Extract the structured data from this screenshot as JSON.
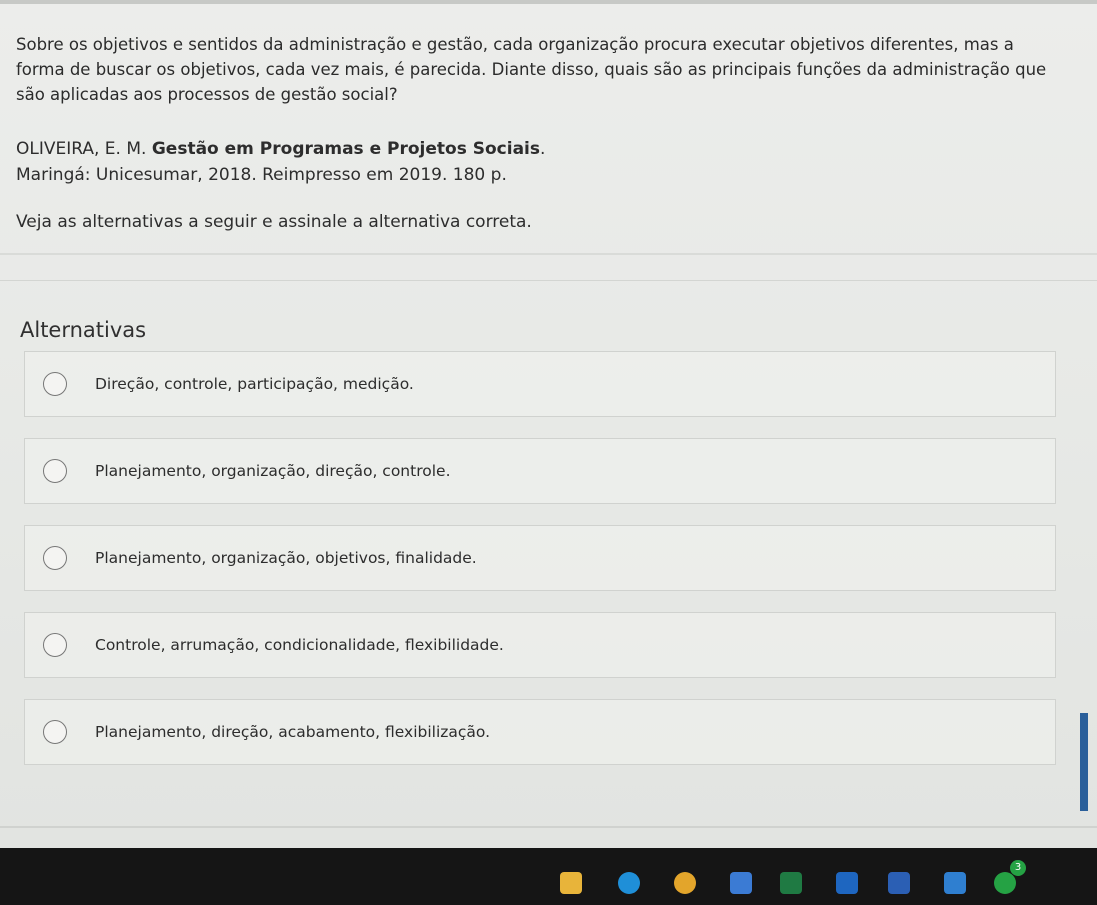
{
  "question": {
    "text": "Sobre os objetivos e sentidos da administração e gestão, cada organização procura executar objetivos diferentes, mas a forma de buscar os objetivos, cada vez mais, é parecida. Diante disso, quais são as principais funções da administração que são aplicadas aos processos de gestão social?",
    "reference_author": "OLIVEIRA, E. M. ",
    "reference_title": "Gestão em Programas e Projetos Sociais",
    "reference_title_end": ".",
    "reference_publisher": "Maringá: Unicesumar, 2018. Reimpresso em 2019. 180 p.",
    "instruction": "Veja as alternativas a seguir e assinale a alternativa correta."
  },
  "alternatives": {
    "title": "Alternativas",
    "options": [
      {
        "label": "Direção, controle, participação, medição."
      },
      {
        "label": "Planejamento, organização, direção, controle."
      },
      {
        "label": "Planejamento, organização, objetivos, finalidade."
      },
      {
        "label": "Controle, arrumação, condicionalidade, flexibilidade."
      },
      {
        "label": "Planejamento, direção, acabamento, flexibilização."
      }
    ]
  },
  "taskbar": {
    "icons": [
      {
        "name": "explorer-icon",
        "color": "#e8b43a"
      },
      {
        "name": "edge-icon",
        "color": "#1f8fd8"
      },
      {
        "name": "chrome-icon",
        "color": "#e3a52b"
      },
      {
        "name": "store-icon",
        "color": "#3b7bd4"
      },
      {
        "name": "excel-icon",
        "color": "#1f7a43"
      },
      {
        "name": "outlook-icon",
        "color": "#1e66c0"
      },
      {
        "name": "word-icon",
        "color": "#2b5fb4"
      },
      {
        "name": "app-icon",
        "color": "#2f7fd0"
      },
      {
        "name": "whatsapp-icon",
        "color": "#25a244"
      }
    ],
    "whatsapp_badge": "3"
  }
}
